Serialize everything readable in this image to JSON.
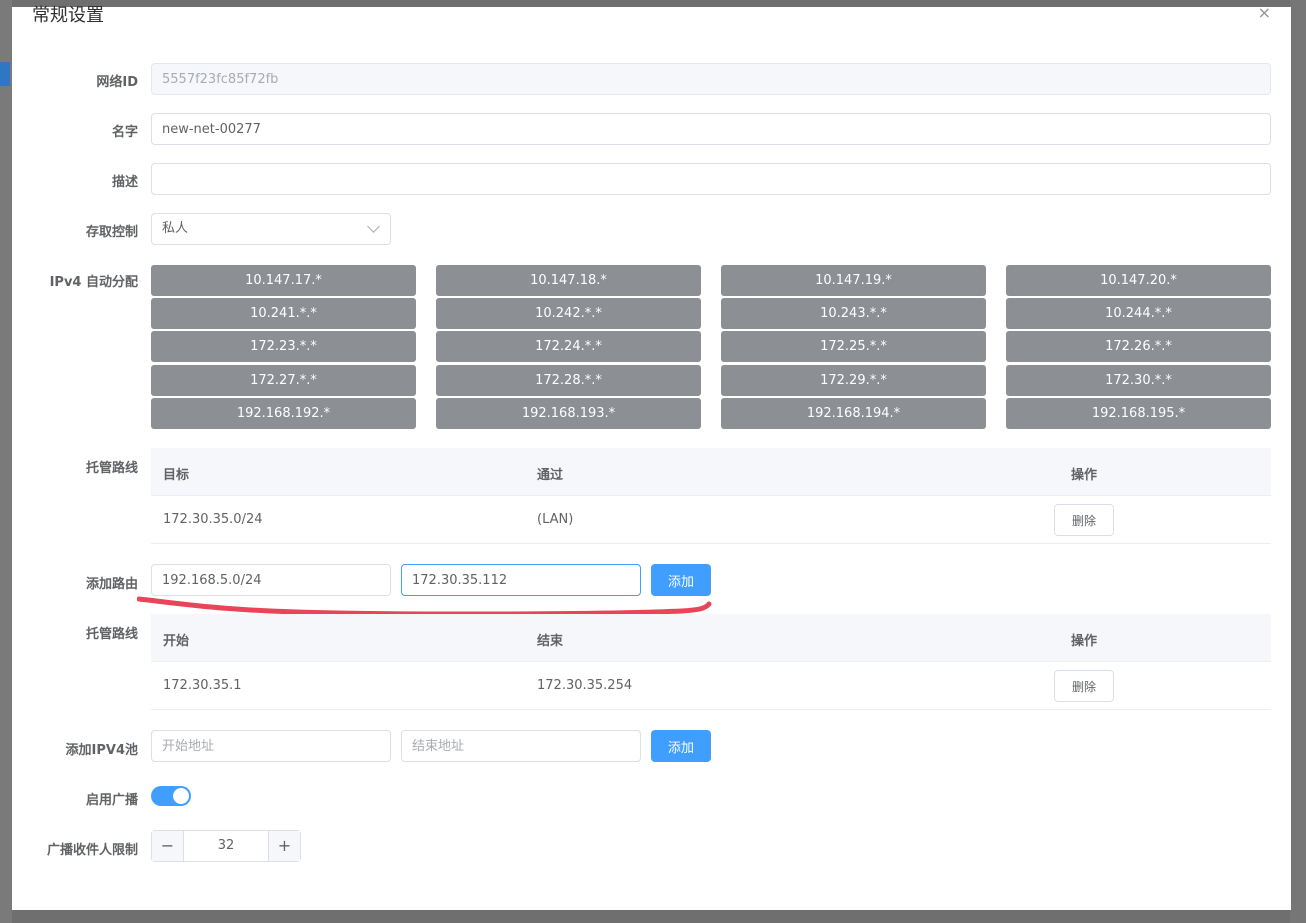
{
  "dialog": {
    "title": "常规设置",
    "close_glyph": "×"
  },
  "form": {
    "network_id": {
      "label": "网络ID",
      "value": "5557f23fc85f72fb"
    },
    "name": {
      "label": "名字",
      "value": "new-net-00277"
    },
    "description": {
      "label": "描述",
      "value": ""
    },
    "access_control": {
      "label": "存取控制",
      "value": "私人"
    },
    "ipv4_auto": {
      "label": "IPv4 自动分配",
      "pools": [
        [
          "10.147.17.*",
          "10.147.18.*",
          "10.147.19.*",
          "10.147.20.*"
        ],
        [
          "10.241.*.*",
          "10.242.*.*",
          "10.243.*.*",
          "10.244.*.*"
        ],
        [
          "172.23.*.*",
          "172.24.*.*",
          "172.25.*.*",
          "172.26.*.*"
        ],
        [
          "172.27.*.*",
          "172.28.*.*",
          "172.29.*.*",
          "172.30.*.*"
        ],
        [
          "192.168.192.*",
          "192.168.193.*",
          "192.168.194.*",
          "192.168.195.*"
        ]
      ]
    },
    "managed_routes": {
      "label": "托管路线",
      "headers": [
        "目标",
        "通过",
        "操作"
      ],
      "rows": [
        {
          "target": "172.30.35.0/24",
          "via": "(LAN)",
          "action": "删除"
        }
      ]
    },
    "add_route": {
      "label": "添加路由",
      "target_value": "192.168.5.0/24",
      "via_value": "172.30.35.112",
      "button": "添加"
    },
    "ipv4_pools": {
      "label": "托管路线",
      "headers": [
        "开始",
        "结束",
        "操作"
      ],
      "rows": [
        {
          "start": "172.30.35.1",
          "end": "172.30.35.254",
          "action": "删除"
        }
      ]
    },
    "add_ipv4_pool": {
      "label": "添加IPV4池",
      "start_placeholder": "开始地址",
      "end_placeholder": "结束地址",
      "button": "添加"
    },
    "enable_broadcast": {
      "label": "启用广播",
      "on": true
    },
    "broadcast_limit": {
      "label": "广播收件人限制",
      "value": "32",
      "minus": "−",
      "plus": "+"
    }
  },
  "colors": {
    "primary": "#409eff",
    "pool_chip": "#8c8f94",
    "annotation": "#e8455a"
  }
}
